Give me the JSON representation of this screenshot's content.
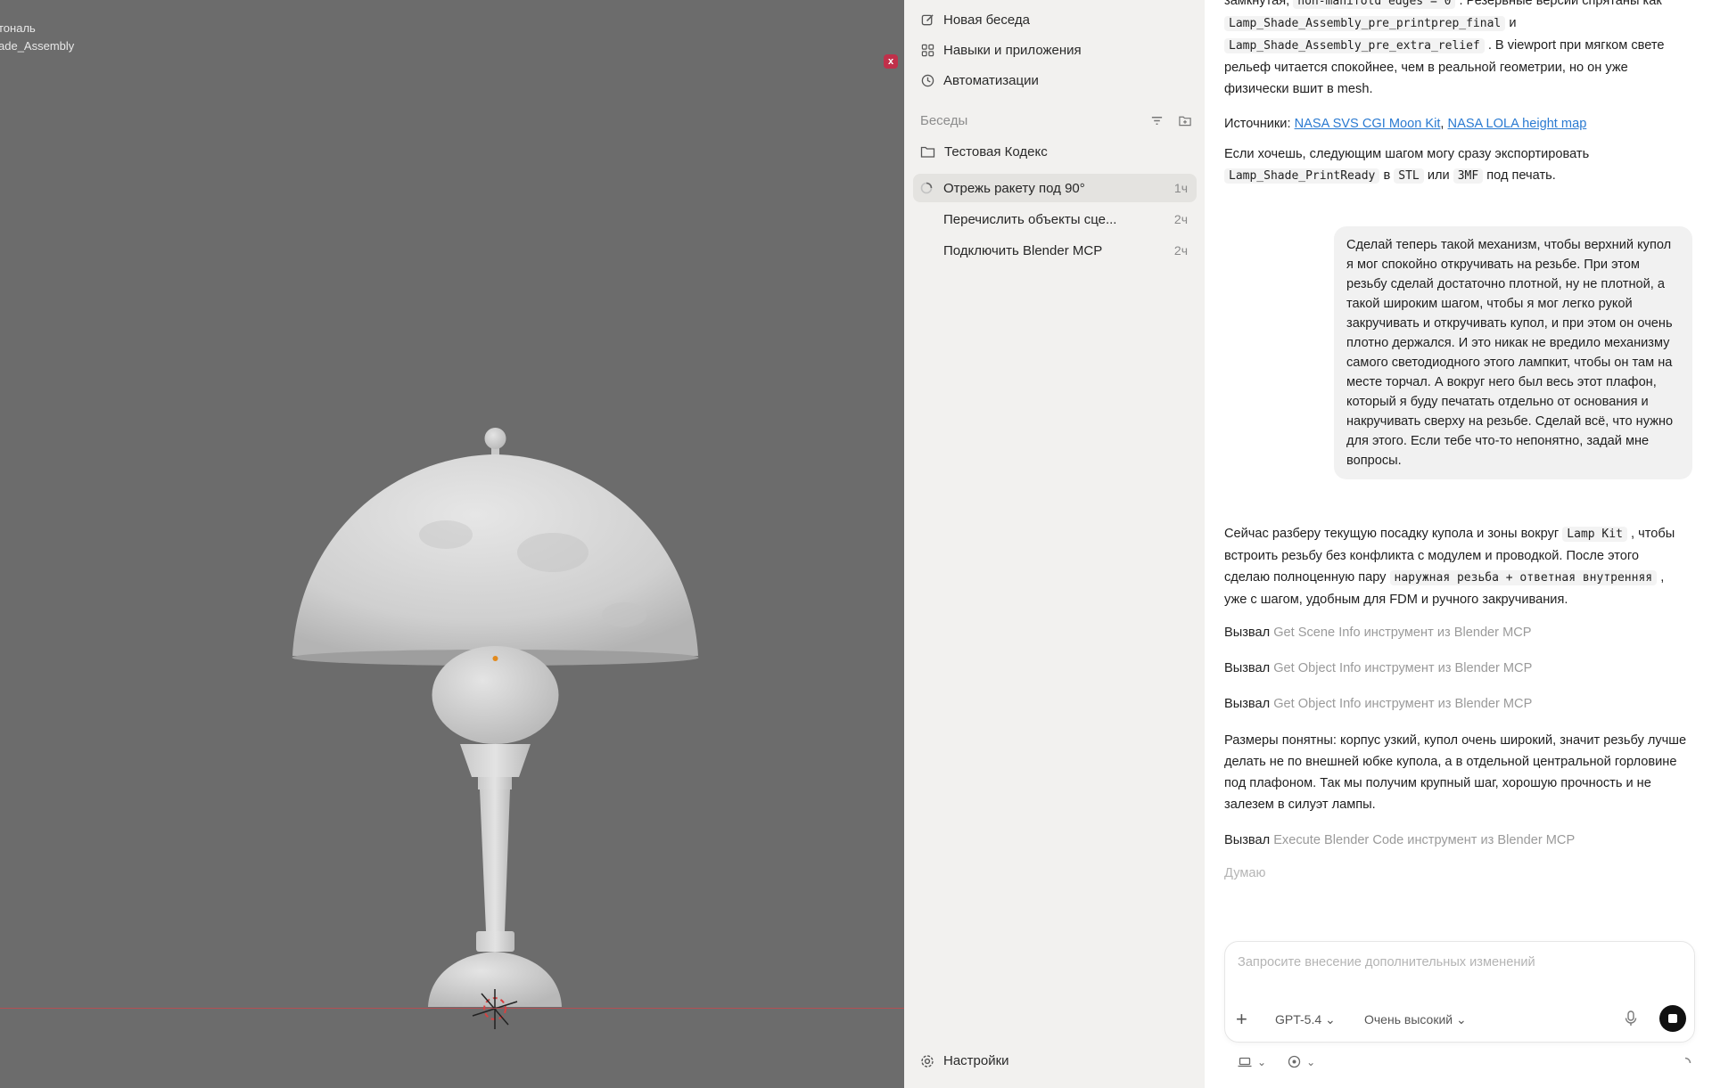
{
  "viewport": {
    "overlay_line1": "тональ",
    "overlay_line2": "ade_Assembly",
    "close_mark": "x"
  },
  "sidebar": {
    "nav": [
      {
        "label": "Новая беседа",
        "icon": "edit-icon"
      },
      {
        "label": "Навыки и приложения",
        "icon": "grid-icon"
      },
      {
        "label": "Автоматизации",
        "icon": "clock-icon"
      }
    ],
    "section_title": "Беседы",
    "folder": "Тестовая Кодекс",
    "conversations": [
      {
        "title": "Отрежь ракету под 90°",
        "time": "1ч",
        "active": true
      },
      {
        "title": "Перечислить объекты сце...",
        "time": "2ч",
        "active": false
      },
      {
        "title": "Подключить Blender MCP",
        "time": "2ч",
        "active": false
      }
    ],
    "settings_label": "Настройки"
  },
  "chat": {
    "top_cut": {
      "t1": "замкнутая,",
      "c1": "non-manifold edges = 0",
      "t2": ". Резервные версии спрятаны как",
      "c2": "Lamp_Shade_Assembly_pre_printprep_final",
      "t3": "и",
      "c3": "Lamp_Shade_Assembly_pre_extra_relief",
      "t4": ". В viewport при мягком свете рельеф читается спокойнее, чем в реальной геометрии, но он уже физически вшит в mesh."
    },
    "sources": {
      "label": "Источники:",
      "link1": "NASA SVS CGI Moon Kit",
      "sep": ",",
      "link2": "NASA LOLA height map"
    },
    "export": {
      "t1": "Если хочешь, следующим шагом могу сразу экспортировать",
      "c1": "Lamp_Shade_PrintReady",
      "t2": "в",
      "c2": "STL",
      "t3": "или",
      "c3": "3MF",
      "t4": "под печать."
    },
    "user_message": "Сделай теперь такой механизм, чтобы верхний купол я мог спокойно откручивать на резьбе. При этом резьбу сделай достаточно плотной, ну не плотной, а такой широким шагом, чтобы я мог легко рукой закручивать и откручивать купол, и при этом он очень плотно держался. И это никак не вредило механизму самого светодиодного этого лампкит, чтобы он там на месте торчал. А вокруг него был весь этот плафон, который я буду печатать отдельно от основания и накручивать сверху на резьбе. Сделай всё, что нужно для этого. Если тебе что-то непонятно, задай мне вопросы.",
    "reply1": {
      "t1": "Сейчас разберу текущую посадку купола и зоны вокруг",
      "c1": "Lamp Kit",
      "t2": ", чтобы встроить резьбу без конфликта с модулем и проводкой. После этого сделаю полноценную пару",
      "c2": "наружная резьба + ответная внутренняя",
      "t3": ", уже с шагом, удобным для FDM и ручного закручивания."
    },
    "tool_prefix": "Вызвал",
    "tools": [
      "Get Scene Info инструмент из Blender MCP",
      "Get Object Info инструмент из Blender MCP",
      "Get Object Info инструмент из Blender MCP"
    ],
    "reply2": "Размеры понятны: корпус узкий, купол очень широкий, значит резьбу лучше делать не по внешней юбке купола, а в отдельной центральной горловине под плафоном. Так мы получим крупный шаг, хорошую прочность и не залезем в силуэт лампы.",
    "tool4": "Execute Blender Code инструмент из Blender MCP",
    "thinking": "Думаю",
    "composer": {
      "placeholder": "Запросите внесение дополнительных изменений",
      "plus": "+",
      "model": "GPT-5.4",
      "effort": "Очень высокий"
    }
  }
}
